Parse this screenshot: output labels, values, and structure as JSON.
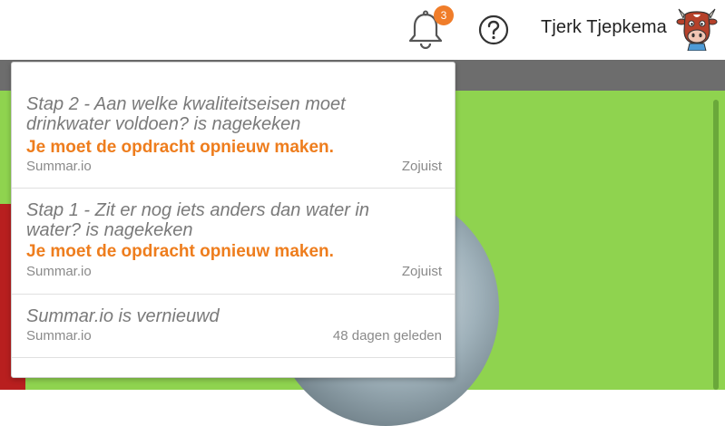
{
  "header": {
    "notification_count": "3",
    "user_name": "Tjerk Tjepkema"
  },
  "notifications": [
    {
      "title": "Stap 2 - Aan welke kwaliteitseisen moet drinkwater voldoen? is nagekeken",
      "status": "Je moet de opdracht opnieuw maken.",
      "source": "Summar.io",
      "time": "Zojuist"
    },
    {
      "title": "Stap 1 - Zit er nog iets anders dan water in water? is nagekeken",
      "status": "Je moet de opdracht opnieuw maken.",
      "source": "Summar.io",
      "time": "Zojuist"
    },
    {
      "title": "Summar.io is vernieuwd",
      "status": "",
      "source": "Summar.io",
      "time": "48 dagen geleden"
    }
  ],
  "colors": {
    "accent": "#ee7d1d",
    "badge": "#f07d2a",
    "background_green": "#8fd34f"
  },
  "icons": [
    "bell-icon",
    "help-icon",
    "avatar-cow-icon"
  ]
}
